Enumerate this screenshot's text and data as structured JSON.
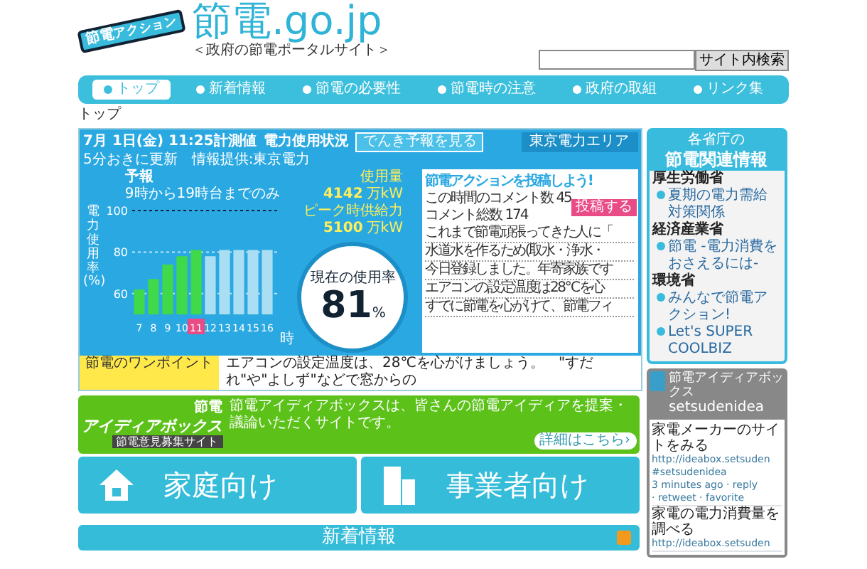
{
  "header": {
    "logo_badge": "節電",
    "logo_badge_sub": "アクション",
    "title": "節電.go.jp",
    "subtitle": "＜政府の節電ポータルサイト＞",
    "search": {
      "button": "サイト内検索"
    }
  },
  "nav": [
    {
      "label": "トップ",
      "selected": true
    },
    {
      "label": "新着情報",
      "selected": false
    },
    {
      "label": "節電の必要性",
      "selected": false
    },
    {
      "label": "節電時の注意",
      "selected": false
    },
    {
      "label": "政府の取組",
      "selected": false
    },
    {
      "label": "リンク集",
      "selected": false
    }
  ],
  "breadcrumb": "トップ",
  "power": {
    "date": "7月 1日(金) 11:25計測値",
    "heading": "電力使用状況",
    "forecast_button": "でんき予報を見る",
    "update_note": "5分おきに更新　情報提供:東京電力",
    "forecast_note": "9時から19時台までのみ",
    "unit": "時",
    "chart_data": {
      "type": "bar",
      "ylabel": "電力使用率(%)",
      "categories": [
        "7",
        "8",
        "9",
        "10",
        "11",
        "12",
        "13",
        "14",
        "15",
        "16"
      ],
      "ylim": [
        50,
        100
      ],
      "yticks": [
        60,
        80,
        100
      ],
      "series": [
        {
          "color": "#3fd94a",
          "values": [
            62,
            67,
            74,
            78,
            81,
            null,
            null,
            null,
            null,
            null
          ]
        },
        {
          "name": "予報",
          "color": "#a9def3",
          "values": [
            null,
            null,
            null,
            null,
            null,
            78,
            81,
            81,
            81,
            81
          ]
        }
      ]
    },
    "usage_label": "使用量",
    "usage_value": "4142",
    "usage_unit": "万kW",
    "supply_label": "ピーク時供給力",
    "supply_value": "5100",
    "supply_unit": "万kW",
    "gauge": {
      "label": "現在の使用率",
      "value": "81",
      "unit": "%"
    },
    "area_tab": "東京電力エリア",
    "comments": {
      "title": "節電アクションを投稿しよう!",
      "hour_label": "この時間のコメント数",
      "hour_count": "45",
      "total_label": "コメント総数",
      "total_count": "174",
      "post_button": "投稿する",
      "lines": [
        "これまで節電頑張ってきた人に「",
        "水道水を作るため(取水・浄水・",
        "今日登録しました。年寄家族です",
        "エアコンの設定温度は28℃を心",
        "すでに節電を心がけて、節電フィ"
      ]
    },
    "tip_label": "節電のワンポイント",
    "tip_text": "エアコンの設定温度は、28℃を心がけましょう。　\"すだれ\"や\"よしず\"などで窓からの"
  },
  "ministries": {
    "title_small": "各省庁の",
    "title": "節電関連情報",
    "groups": [
      {
        "name": "厚生労働省",
        "links": [
          "夏期の電力需給対策関係"
        ]
      },
      {
        "name": "経済産業省",
        "links": [
          "節電 -電力消費をおさえるには-"
        ]
      },
      {
        "name": "環境省",
        "links": [
          "みんなで節電アクション!",
          "Let's SUPER COOLBIZ"
        ]
      }
    ]
  },
  "ideabox": {
    "logo_small": "節電",
    "logo": "アイディアボックス",
    "logo_sub": "節電意見募集サイト",
    "text": "節電アイディアボックスは、皆さんの節電アイディアを提案・議論いただくサイトです。",
    "button": "詳細はこちら›"
  },
  "targets": [
    {
      "label": "家庭向け",
      "kind": "house"
    },
    {
      "label": "事業者向け",
      "kind": "building"
    }
  ],
  "news": {
    "title": "新着情報"
  },
  "twitter": {
    "name": "節電アイディアボックス",
    "handle": "setsudenidea",
    "tweets": [
      {
        "text": "家電メーカーのサイトをみる",
        "link": "http://ideabox.setsuden",
        "tag": "#setsudenidea",
        "meta": [
          "3 minutes ago · reply",
          "· retweet · favorite"
        ]
      },
      {
        "text": "家電の電力消費量を調べる",
        "link": "http://ideabox.setsuden"
      }
    ]
  }
}
